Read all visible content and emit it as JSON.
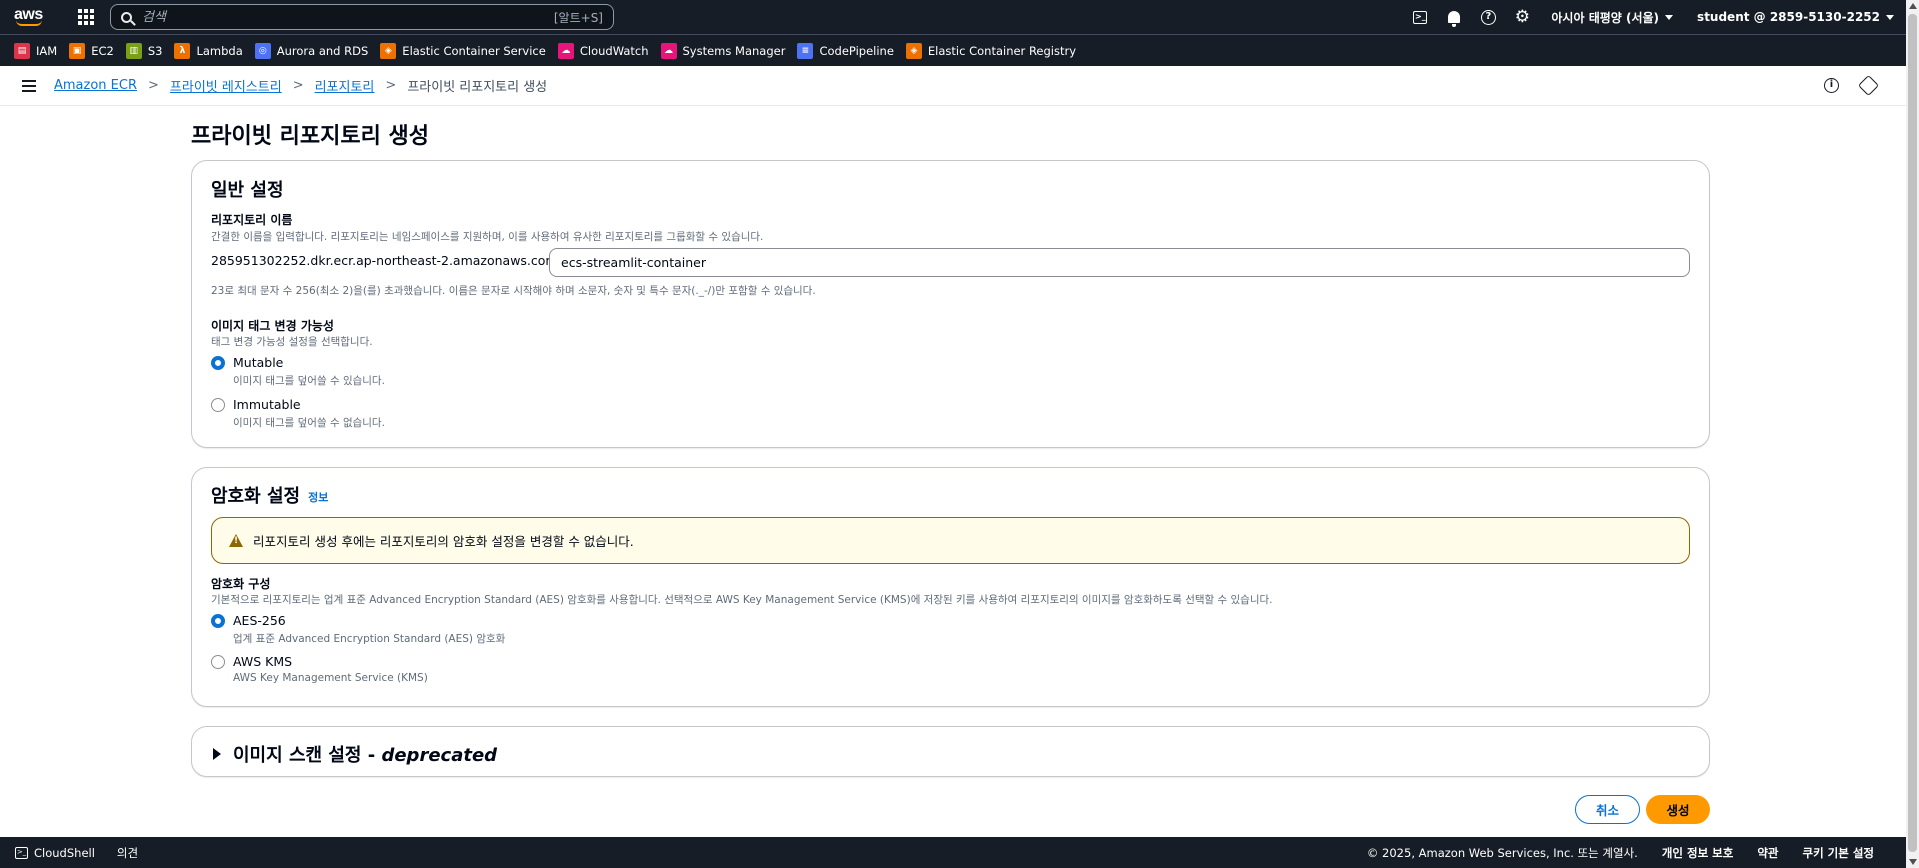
{
  "topnav": {
    "logo": "aws",
    "search_placeholder": "검색",
    "search_shortcut": "[알트+S]",
    "region": "아시아 태평양 (서울)",
    "account": "student @ 2859-5130-2252",
    "icons": [
      "cloudshell-icon",
      "bell-icon",
      "help-icon",
      "gear-icon"
    ]
  },
  "favorites": [
    {
      "label": "IAM",
      "color": "#dd344c"
    },
    {
      "label": "EC2",
      "color": "#ed7100"
    },
    {
      "label": "S3",
      "color": "#7aa116"
    },
    {
      "label": "Lambda",
      "color": "#ed7100"
    },
    {
      "label": "Aurora and RDS",
      "color": "#4d72f3"
    },
    {
      "label": "Elastic Container Service",
      "color": "#ed7100"
    },
    {
      "label": "CloudWatch",
      "color": "#e7157b"
    },
    {
      "label": "Systems Manager",
      "color": "#e7157b"
    },
    {
      "label": "CodePipeline",
      "color": "#4d72f3"
    },
    {
      "label": "Elastic Container Registry",
      "color": "#ed7100"
    }
  ],
  "breadcrumb": {
    "items": [
      "Amazon ECR",
      "프라이빗 레지스트리",
      "리포지토리"
    ],
    "current": "프라이빗 리포지토리 생성"
  },
  "page": {
    "title": "프라이빗 리포지토리 생성"
  },
  "general": {
    "heading": "일반 설정",
    "repo_name_label": "리포지토리 이름",
    "repo_name_desc": "간결한 이름을 입력합니다. 리포지토리는 네임스페이스를 지원하며, 이를 사용하여 유사한 리포지토리를 그룹화할 수 있습니다.",
    "prefix": "285951302252.dkr.ecr.ap-northeast-2.amazonaws.com/",
    "repo_name_value": "ecs-streamlit-container",
    "repo_name_hint": "23로 최대 문자 수 256(최소 2)을(를) 초과했습니다. 이름은 문자로 시작해야 하며 소문자, 숫자 및 특수 문자(._-/)만 포함할 수 있습니다.",
    "tag_label": "이미지 태그 변경 가능성",
    "tag_desc": "태그 변경 가능성 설정을 선택합니다.",
    "mutable_label": "Mutable",
    "mutable_desc": "이미지 태그를 덮어쓸 수 있습니다.",
    "immutable_label": "Immutable",
    "immutable_desc": "이미지 태그를 덮어쓸 수 없습니다."
  },
  "encryption": {
    "heading": "암호화 설정",
    "info_link": "정보",
    "alert": "리포지토리 생성 후에는 리포지토리의 암호화 설정을 변경할 수 없습니다.",
    "config_label": "암호화 구성",
    "config_desc": "기본적으로 리포지토리는 업계 표준 Advanced Encryption Standard (AES) 암호화를 사용합니다. 선택적으로 AWS Key Management Service (KMS)에 저장된 키를 사용하여 리포지토리의 이미지를 암호화하도록 선택할 수 있습니다.",
    "aes_label": "AES-256",
    "aes_desc": "업계 표준 Advanced Encryption Standard (AES) 암호화",
    "kms_label": "AWS KMS",
    "kms_desc": "AWS Key Management Service (KMS)"
  },
  "scan": {
    "heading": "이미지 스캔 설정 - ",
    "heading_italic": "deprecated"
  },
  "actions": {
    "cancel": "취소",
    "create": "생성"
  },
  "footer": {
    "cloudshell": "CloudShell",
    "feedback": "의견",
    "copyright": "© 2025, Amazon Web Services, Inc. 또는 계열사.",
    "privacy": "개인 정보 보호",
    "terms": "약관",
    "cookies": "쿠키 기본 설정"
  },
  "colors": {
    "nav_bg": "#161d26",
    "link": "#0972d3",
    "primary_button": "#ff9900",
    "warning_border": "#8d6605",
    "warning_bg": "#fffce9"
  }
}
